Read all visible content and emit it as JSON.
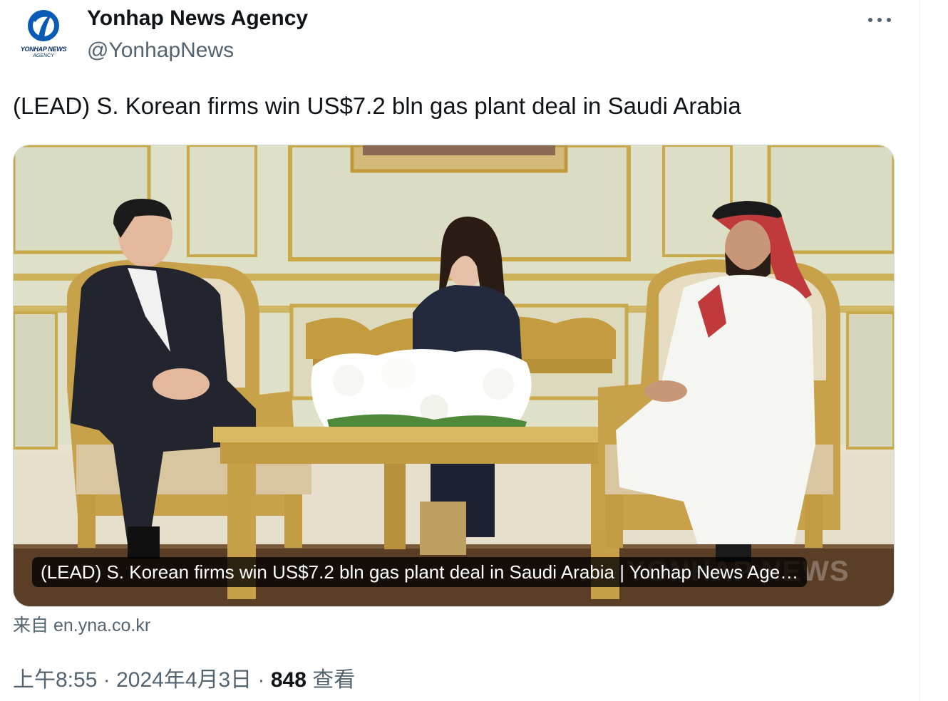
{
  "author": {
    "display_name": "Yonhap News Agency",
    "handle": "@YonhapNews",
    "avatar_text": "YONHAP NEWS",
    "avatar_subtext": "AGENCY"
  },
  "tweet": {
    "text": "(LEAD) S. Korean firms win US$7.2 bln gas plant deal in Saudi Arabia"
  },
  "card": {
    "caption": "(LEAD) S. Korean firms win US$7.2 bln gas plant deal in Saudi Arabia | Yonhap News Age…",
    "watermark": "YONHAP NEWS",
    "source_prefix": "来自",
    "source_domain": "en.yna.co.kr"
  },
  "meta": {
    "time": "上午8:55",
    "separator": "·",
    "date": "2024年4月3日",
    "views_count": "848",
    "views_label": "查看"
  },
  "icons": {
    "more": "more-horizontal-icon"
  },
  "colors": {
    "text_primary": "#0f1419",
    "text_secondary": "#536471",
    "border": "#cfd9de",
    "logo_blue": "#0a5bb5"
  }
}
